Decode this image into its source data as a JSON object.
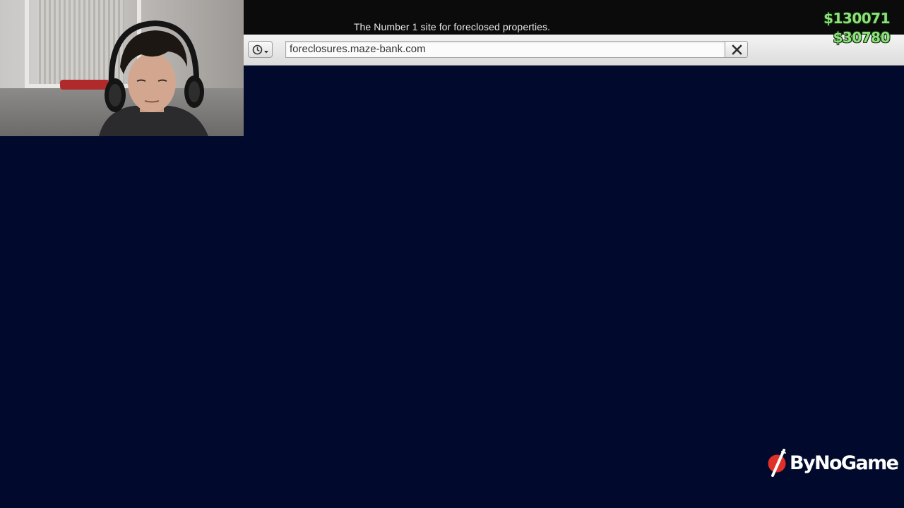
{
  "browser": {
    "tagline": "The Number 1 site for foreclosed properties.",
    "url": "foreclosures.maze-bank.com"
  },
  "hud": {
    "cash": "$130071",
    "bank": "$30780"
  },
  "watermark": {
    "text": "ByNoGame"
  },
  "colors": {
    "page_background": "#010a2c",
    "money": "#8ee07a",
    "top_strip": "#0b0b0c",
    "watermark_logo": "#e0302a"
  },
  "icons": {
    "history": "clock-dropdown-icon",
    "close": "close-icon",
    "logo": "bynogame-logo-icon"
  }
}
